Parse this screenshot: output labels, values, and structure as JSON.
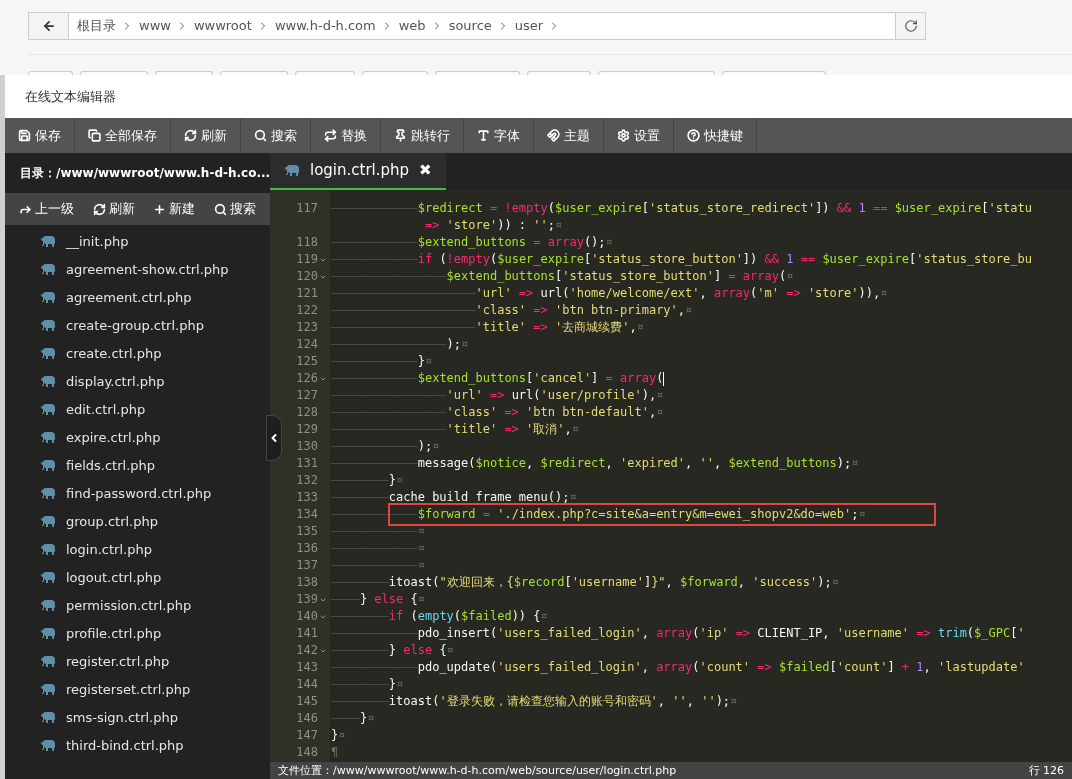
{
  "breadcrumb": {
    "items": [
      "根目录",
      "www",
      "wwwroot",
      "www.h-d-h.com",
      "web",
      "source",
      "user"
    ]
  },
  "window": {
    "title": "在线文本编辑器"
  },
  "toolbar": [
    "保存",
    "全部保存",
    "刷新",
    "搜索",
    "替换",
    "跳转行",
    "字体",
    "主题",
    "设置",
    "快捷键"
  ],
  "sidebar": {
    "path": "目录：/www/wwwroot/www.h-d-h.co...",
    "actions": [
      "上一级",
      "刷新",
      "新建",
      "搜索"
    ],
    "files": [
      "__init.php",
      "agreement-show.ctrl.php",
      "agreement.ctrl.php",
      "create-group.ctrl.php",
      "create.ctrl.php",
      "display.ctrl.php",
      "edit.ctrl.php",
      "expire.ctrl.php",
      "fields.ctrl.php",
      "find-password.ctrl.php",
      "group.ctrl.php",
      "login.ctrl.php",
      "logout.ctrl.php",
      "permission.ctrl.php",
      "profile.ctrl.php",
      "register.ctrl.php",
      "registerset.ctrl.php",
      "sms-sign.ctrl.php",
      "third-bind.ctrl.php"
    ]
  },
  "tabs": [
    {
      "label": "login.ctrl.php",
      "selected": true,
      "close": "✖"
    }
  ],
  "lines": [
    {
      "number": "117",
      "fold": false,
      "highlighted": false,
      "cursor": false,
      "tokens": [
        {
          "kind": "indent",
          "text": "————————————"
        },
        {
          "kind": "var",
          "text": "$redirect"
        },
        {
          "kind": "kw",
          "text": " = "
        },
        {
          "kind": "kw",
          "text": "!empty"
        },
        {
          "kind": "plain",
          "text": "("
        },
        {
          "kind": "var",
          "text": "$user_expire"
        },
        {
          "kind": "plain",
          "text": "["
        },
        {
          "kind": "str",
          "text": "'status_store_redirect'"
        },
        {
          "kind": "plain",
          "text": "]) "
        },
        {
          "kind": "kw",
          "text": "&& "
        },
        {
          "kind": "num",
          "text": "1"
        },
        {
          "kind": "kw",
          "text": " == "
        },
        {
          "kind": "var",
          "text": "$user_expire"
        },
        {
          "kind": "plain",
          "text": "["
        },
        {
          "kind": "str",
          "text": "'statu"
        }
      ]
    },
    {
      "fold": false,
      "highlighted": false,
      "cursor": false,
      "tokens": [
        {
          "kind": "kw",
          "text": "             => "
        },
        {
          "kind": "str",
          "text": "'store'"
        },
        {
          "kind": "plain",
          "text": ")) : "
        },
        {
          "kind": "str",
          "text": "''"
        },
        {
          "kind": "plain",
          "text": ";"
        },
        {
          "kind": "eol",
          "text": "¤"
        }
      ]
    },
    {
      "number": "118",
      "fold": false,
      "highlighted": false,
      "cursor": false,
      "tokens": [
        {
          "kind": "indent",
          "text": "————————————"
        },
        {
          "kind": "var",
          "text": "$extend_buttons"
        },
        {
          "kind": "kw",
          "text": " = array"
        },
        {
          "kind": "plain",
          "text": "();"
        },
        {
          "kind": "eol",
          "text": "¤"
        }
      ]
    },
    {
      "number": "119",
      "fold": true,
      "highlighted": false,
      "cursor": false,
      "tokens": [
        {
          "kind": "indent",
          "text": "————————————"
        },
        {
          "kind": "kw",
          "text": "if"
        },
        {
          "kind": "plain",
          "text": " ("
        },
        {
          "kind": "kw",
          "text": "!empty"
        },
        {
          "kind": "plain",
          "text": "("
        },
        {
          "kind": "var",
          "text": "$user_expire"
        },
        {
          "kind": "plain",
          "text": "["
        },
        {
          "kind": "str",
          "text": "'status_store_button'"
        },
        {
          "kind": "plain",
          "text": "]) "
        },
        {
          "kind": "kw",
          "text": "&& "
        },
        {
          "kind": "num",
          "text": "1"
        },
        {
          "kind": "kw",
          "text": " == "
        },
        {
          "kind": "var",
          "text": "$user_expire"
        },
        {
          "kind": "plain",
          "text": "["
        },
        {
          "kind": "str",
          "text": "'status_store_bu"
        }
      ]
    },
    {
      "number": "120",
      "fold": true,
      "highlighted": false,
      "cursor": false,
      "tokens": [
        {
          "kind": "indent",
          "text": "————————————————"
        },
        {
          "kind": "var",
          "text": "$extend_buttons"
        },
        {
          "kind": "plain",
          "text": "["
        },
        {
          "kind": "str",
          "text": "'status_store_button'"
        },
        {
          "kind": "plain",
          "text": "]"
        },
        {
          "kind": "kw",
          "text": " = array"
        },
        {
          "kind": "plain",
          "text": "("
        },
        {
          "kind": "eol",
          "text": "¤"
        }
      ]
    },
    {
      "number": "121",
      "fold": false,
      "highlighted": false,
      "cursor": false,
      "tokens": [
        {
          "kind": "indent",
          "text": "————————————————————"
        },
        {
          "kind": "str",
          "text": "'url'"
        },
        {
          "kind": "kw",
          "text": " => "
        },
        {
          "kind": "plain",
          "text": "url("
        },
        {
          "kind": "str",
          "text": "'home/welcome/ext'"
        },
        {
          "kind": "plain",
          "text": ", "
        },
        {
          "kind": "kw",
          "text": "array"
        },
        {
          "kind": "plain",
          "text": "("
        },
        {
          "kind": "str",
          "text": "'m'"
        },
        {
          "kind": "kw",
          "text": " => "
        },
        {
          "kind": "str",
          "text": "'store'"
        },
        {
          "kind": "plain",
          "text": ")),"
        },
        {
          "kind": "eol",
          "text": "¤"
        }
      ]
    },
    {
      "number": "122",
      "fold": false,
      "highlighted": false,
      "cursor": false,
      "tokens": [
        {
          "kind": "indent",
          "text": "————————————————————"
        },
        {
          "kind": "str",
          "text": "'class'"
        },
        {
          "kind": "kw",
          "text": " => "
        },
        {
          "kind": "str",
          "text": "'btn btn-primary'"
        },
        {
          "kind": "plain",
          "text": ","
        },
        {
          "kind": "eol",
          "text": "¤"
        }
      ]
    },
    {
      "number": "123",
      "fold": false,
      "highlighted": false,
      "cursor": false,
      "tokens": [
        {
          "kind": "indent",
          "text": "————————————————————"
        },
        {
          "kind": "str",
          "text": "'title'"
        },
        {
          "kind": "kw",
          "text": " => "
        },
        {
          "kind": "str",
          "text": "'去商城续费'"
        },
        {
          "kind": "plain",
          "text": ","
        },
        {
          "kind": "eol",
          "text": "¤"
        }
      ]
    },
    {
      "number": "124",
      "fold": false,
      "highlighted": false,
      "cursor": false,
      "tokens": [
        {
          "kind": "indent",
          "text": "————————————————"
        },
        {
          "kind": "plain",
          "text": ");"
        },
        {
          "kind": "eol",
          "text": "¤"
        }
      ]
    },
    {
      "number": "125",
      "fold": false,
      "highlighted": false,
      "cursor": false,
      "tokens": [
        {
          "kind": "indent",
          "text": "————————————"
        },
        {
          "kind": "plain",
          "text": "}"
        },
        {
          "kind": "eol",
          "text": "¤"
        }
      ]
    },
    {
      "number": "126",
      "fold": true,
      "highlighted": false,
      "cursor": true,
      "tokens": [
        {
          "kind": "indent",
          "text": "————————————"
        },
        {
          "kind": "var",
          "text": "$extend_buttons"
        },
        {
          "kind": "plain",
          "text": "["
        },
        {
          "kind": "str",
          "text": "'cancel'"
        },
        {
          "kind": "plain",
          "text": "]"
        },
        {
          "kind": "kw",
          "text": " = array"
        },
        {
          "kind": "plain",
          "text": "("
        }
      ]
    },
    {
      "number": "127",
      "fold": false,
      "highlighted": false,
      "cursor": false,
      "tokens": [
        {
          "kind": "indent",
          "text": "————————————————"
        },
        {
          "kind": "str",
          "text": "'url'"
        },
        {
          "kind": "kw",
          "text": " => "
        },
        {
          "kind": "plain",
          "text": "url("
        },
        {
          "kind": "str",
          "text": "'user/profile'"
        },
        {
          "kind": "plain",
          "text": "),"
        },
        {
          "kind": "eol",
          "text": "¤"
        }
      ]
    },
    {
      "number": "128",
      "fold": false,
      "highlighted": false,
      "cursor": false,
      "tokens": [
        {
          "kind": "indent",
          "text": "————————————————"
        },
        {
          "kind": "str",
          "text": "'class'"
        },
        {
          "kind": "kw",
          "text": " => "
        },
        {
          "kind": "str",
          "text": "'btn btn-default'"
        },
        {
          "kind": "plain",
          "text": ","
        },
        {
          "kind": "eol",
          "text": "¤"
        }
      ]
    },
    {
      "number": "129",
      "fold": false,
      "highlighted": false,
      "cursor": false,
      "tokens": [
        {
          "kind": "indent",
          "text": "————————————————"
        },
        {
          "kind": "str",
          "text": "'title'"
        },
        {
          "kind": "kw",
          "text": " => "
        },
        {
          "kind": "str",
          "text": "'取消'"
        },
        {
          "kind": "plain",
          "text": ","
        },
        {
          "kind": "eol",
          "text": "¤"
        }
      ]
    },
    {
      "number": "130",
      "fold": false,
      "highlighted": false,
      "cursor": false,
      "tokens": [
        {
          "kind": "indent",
          "text": "————————————"
        },
        {
          "kind": "plain",
          "text": ");"
        },
        {
          "kind": "eol",
          "text": "¤"
        }
      ]
    },
    {
      "number": "131",
      "fold": false,
      "highlighted": false,
      "cursor": false,
      "tokens": [
        {
          "kind": "indent",
          "text": "————————————"
        },
        {
          "kind": "plain",
          "text": "message("
        },
        {
          "kind": "var",
          "text": "$notice"
        },
        {
          "kind": "plain",
          "text": ", "
        },
        {
          "kind": "var",
          "text": "$redirect"
        },
        {
          "kind": "plain",
          "text": ", "
        },
        {
          "kind": "str",
          "text": "'expired'"
        },
        {
          "kind": "plain",
          "text": ", "
        },
        {
          "kind": "str",
          "text": "''"
        },
        {
          "kind": "plain",
          "text": ", "
        },
        {
          "kind": "var",
          "text": "$extend_buttons"
        },
        {
          "kind": "plain",
          "text": ");"
        },
        {
          "kind": "eol",
          "text": "¤"
        }
      ]
    },
    {
      "number": "132",
      "fold": false,
      "highlighted": false,
      "cursor": false,
      "tokens": [
        {
          "kind": "indent",
          "text": "————————"
        },
        {
          "kind": "plain",
          "text": "}"
        },
        {
          "kind": "eol",
          "text": "¤"
        }
      ]
    },
    {
      "number": "133",
      "fold": false,
      "highlighted": false,
      "cursor": false,
      "tokens": [
        {
          "kind": "indent",
          "text": "————————"
        },
        {
          "kind": "plain",
          "text": "cache_build_frame_menu();"
        },
        {
          "kind": "eol",
          "text": "¤"
        }
      ]
    },
    {
      "number": "134",
      "fold": false,
      "highlighted": true,
      "cursor": false,
      "tokens": [
        {
          "kind": "indent",
          "text": "————————————"
        },
        {
          "kind": "var",
          "text": "$forward"
        },
        {
          "kind": "kw",
          "text": " = "
        },
        {
          "kind": "str",
          "text": "'./index.php?c=site&a=entry&m=ewei_shopv2&do=web'"
        },
        {
          "kind": "plain",
          "text": ";"
        },
        {
          "kind": "eol",
          "text": "¤"
        }
      ]
    },
    {
      "number": "135",
      "fold": false,
      "highlighted": false,
      "cursor": false,
      "tokens": [
        {
          "kind": "indent",
          "text": "————————————"
        },
        {
          "kind": "eol",
          "text": "¤"
        }
      ]
    },
    {
      "number": "136",
      "fold": false,
      "highlighted": false,
      "cursor": false,
      "tokens": [
        {
          "kind": "indent",
          "text": "————————————"
        },
        {
          "kind": "eol",
          "text": "¤"
        }
      ]
    },
    {
      "number": "137",
      "fold": false,
      "highlighted": false,
      "cursor": false,
      "tokens": [
        {
          "kind": "indent",
          "text": "————————————"
        },
        {
          "kind": "eol",
          "text": "¤"
        }
      ]
    },
    {
      "number": "138",
      "fold": false,
      "highlighted": false,
      "cursor": false,
      "tokens": [
        {
          "kind": "indent",
          "text": "————————"
        },
        {
          "kind": "plain",
          "text": "itoast("
        },
        {
          "kind": "str",
          "text": "\"欢迎回来，{"
        },
        {
          "kind": "var",
          "text": "$record"
        },
        {
          "kind": "plain",
          "text": "["
        },
        {
          "kind": "str",
          "text": "'username'"
        },
        {
          "kind": "plain",
          "text": "]"
        },
        {
          "kind": "str",
          "text": "}\""
        },
        {
          "kind": "plain",
          "text": ", "
        },
        {
          "kind": "var",
          "text": "$forward"
        },
        {
          "kind": "plain",
          "text": ", "
        },
        {
          "kind": "str",
          "text": "'success'"
        },
        {
          "kind": "plain",
          "text": ");"
        },
        {
          "kind": "eol",
          "text": "¤"
        }
      ]
    },
    {
      "number": "139",
      "fold": true,
      "highlighted": false,
      "cursor": false,
      "tokens": [
        {
          "kind": "indent",
          "text": "————"
        },
        {
          "kind": "plain",
          "text": "} "
        },
        {
          "kind": "kw",
          "text": "else"
        },
        {
          "kind": "plain",
          "text": " {"
        },
        {
          "kind": "eol",
          "text": "¤"
        }
      ]
    },
    {
      "number": "140",
      "fold": true,
      "highlighted": false,
      "cursor": false,
      "tokens": [
        {
          "kind": "indent",
          "text": "————————"
        },
        {
          "kind": "kw",
          "text": "if"
        },
        {
          "kind": "plain",
          "text": " ("
        },
        {
          "kind": "fn",
          "text": "empty"
        },
        {
          "kind": "plain",
          "text": "("
        },
        {
          "kind": "var",
          "text": "$failed"
        },
        {
          "kind": "plain",
          "text": ")) {"
        },
        {
          "kind": "eol",
          "text": "¤"
        }
      ]
    },
    {
      "number": "141",
      "fold": false,
      "highlighted": false,
      "cursor": false,
      "tokens": [
        {
          "kind": "indent",
          "text": "————————————"
        },
        {
          "kind": "plain",
          "text": "pdo_insert("
        },
        {
          "kind": "str",
          "text": "'users_failed_login'"
        },
        {
          "kind": "plain",
          "text": ", "
        },
        {
          "kind": "kw",
          "text": "array"
        },
        {
          "kind": "plain",
          "text": "("
        },
        {
          "kind": "str",
          "text": "'ip'"
        },
        {
          "kind": "kw",
          "text": " => "
        },
        {
          "kind": "plain",
          "text": "CLIENT_IP, "
        },
        {
          "kind": "str",
          "text": "'username'"
        },
        {
          "kind": "kw",
          "text": " => "
        },
        {
          "kind": "fn",
          "text": "trim"
        },
        {
          "kind": "plain",
          "text": "("
        },
        {
          "kind": "var",
          "text": "$_GPC"
        },
        {
          "kind": "plain",
          "text": "["
        },
        {
          "kind": "str",
          "text": "'"
        }
      ]
    },
    {
      "number": "142",
      "fold": true,
      "highlighted": false,
      "cursor": false,
      "tokens": [
        {
          "kind": "indent",
          "text": "————————"
        },
        {
          "kind": "plain",
          "text": "} "
        },
        {
          "kind": "kw",
          "text": "else"
        },
        {
          "kind": "plain",
          "text": " {"
        },
        {
          "kind": "eol",
          "text": "¤"
        }
      ]
    },
    {
      "number": "143",
      "fold": false,
      "highlighted": false,
      "cursor": false,
      "tokens": [
        {
          "kind": "indent",
          "text": "————————————"
        },
        {
          "kind": "plain",
          "text": "pdo_update("
        },
        {
          "kind": "str",
          "text": "'users_failed_login'"
        },
        {
          "kind": "plain",
          "text": ", "
        },
        {
          "kind": "kw",
          "text": "array"
        },
        {
          "kind": "plain",
          "text": "("
        },
        {
          "kind": "str",
          "text": "'count'"
        },
        {
          "kind": "kw",
          "text": " => "
        },
        {
          "kind": "var",
          "text": "$failed"
        },
        {
          "kind": "plain",
          "text": "["
        },
        {
          "kind": "str",
          "text": "'count'"
        },
        {
          "kind": "plain",
          "text": "]"
        },
        {
          "kind": "kw",
          "text": " + "
        },
        {
          "kind": "num",
          "text": "1"
        },
        {
          "kind": "plain",
          "text": ", "
        },
        {
          "kind": "str",
          "text": "'lastupdate'"
        }
      ]
    },
    {
      "number": "144",
      "fold": false,
      "highlighted": false,
      "cursor": false,
      "tokens": [
        {
          "kind": "indent",
          "text": "————————"
        },
        {
          "kind": "plain",
          "text": "}"
        },
        {
          "kind": "eol",
          "text": "¤"
        }
      ]
    },
    {
      "number": "145",
      "fold": false,
      "highlighted": false,
      "cursor": false,
      "tokens": [
        {
          "kind": "indent",
          "text": "————————"
        },
        {
          "kind": "plain",
          "text": "itoast("
        },
        {
          "kind": "str",
          "text": "'登录失败，请检查您输入的账号和密码'"
        },
        {
          "kind": "plain",
          "text": ", "
        },
        {
          "kind": "str",
          "text": "''"
        },
        {
          "kind": "plain",
          "text": ", "
        },
        {
          "kind": "str",
          "text": "''"
        },
        {
          "kind": "plain",
          "text": ");"
        },
        {
          "kind": "eol",
          "text": "¤"
        }
      ]
    },
    {
      "number": "146",
      "fold": false,
      "highlighted": false,
      "cursor": false,
      "tokens": [
        {
          "kind": "indent",
          "text": "————"
        },
        {
          "kind": "plain",
          "text": "}"
        },
        {
          "kind": "eol",
          "text": "¤"
        }
      ]
    },
    {
      "number": "147",
      "fold": false,
      "highlighted": false,
      "cursor": false,
      "tokens": [
        {
          "kind": "plain",
          "text": "}"
        },
        {
          "kind": "eol",
          "text": "¤"
        }
      ]
    },
    {
      "number": "148",
      "fold": false,
      "highlighted": false,
      "cursor": false,
      "tokens": [
        {
          "kind": "eol",
          "text": "¶"
        }
      ]
    }
  ],
  "status_bar": {
    "file_path": "文件位置：/www/wwwroot/www.h-d-h.com/web/source/user/login.ctrl.php",
    "position": "行 126"
  }
}
